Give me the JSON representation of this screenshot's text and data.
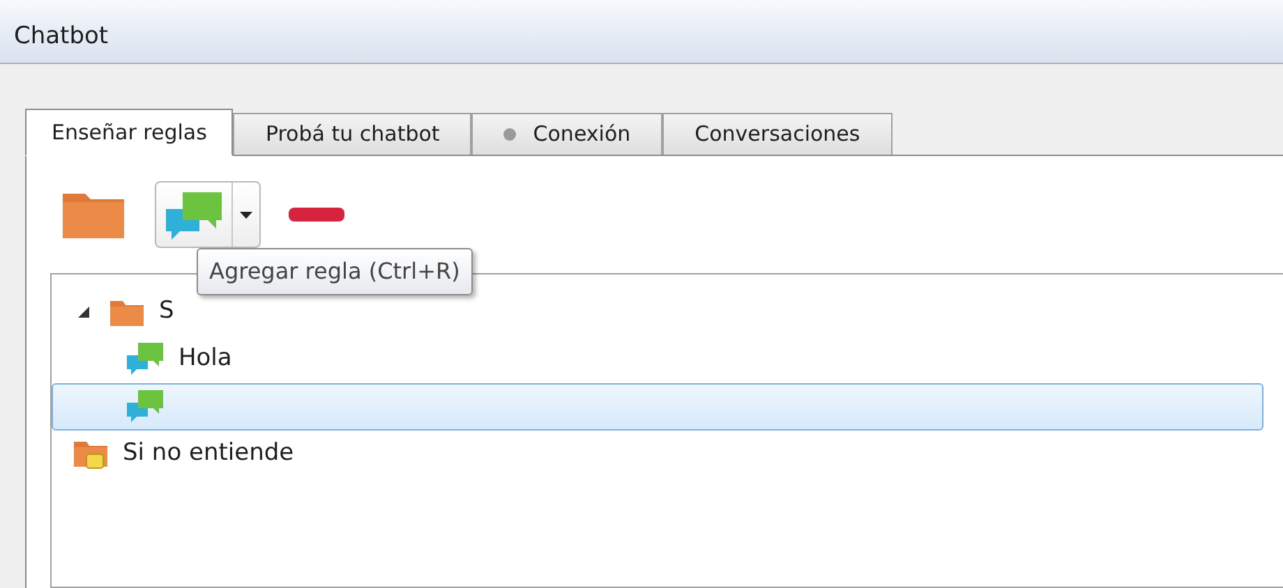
{
  "window": {
    "title": "Chatbot"
  },
  "tabs": [
    {
      "label": "Enseñar reglas",
      "selected": true,
      "indicator": false
    },
    {
      "label": "Probá tu chatbot",
      "selected": false,
      "indicator": false
    },
    {
      "label": "Conexión",
      "selected": false,
      "indicator": true
    },
    {
      "label": "Conversaciones",
      "selected": false,
      "indicator": false
    }
  ],
  "toolbar": {
    "tooltip": "Agregar regla (Ctrl+R)"
  },
  "tree": [
    {
      "kind": "folder",
      "label": "S",
      "expanded": true,
      "selected": false,
      "children": [
        {
          "kind": "rule",
          "label": "Hola",
          "selected": false
        },
        {
          "kind": "rule",
          "selected": true
        }
      ]
    },
    {
      "kind": "fallback",
      "label": "Si no entiende",
      "selected": false
    }
  ]
}
